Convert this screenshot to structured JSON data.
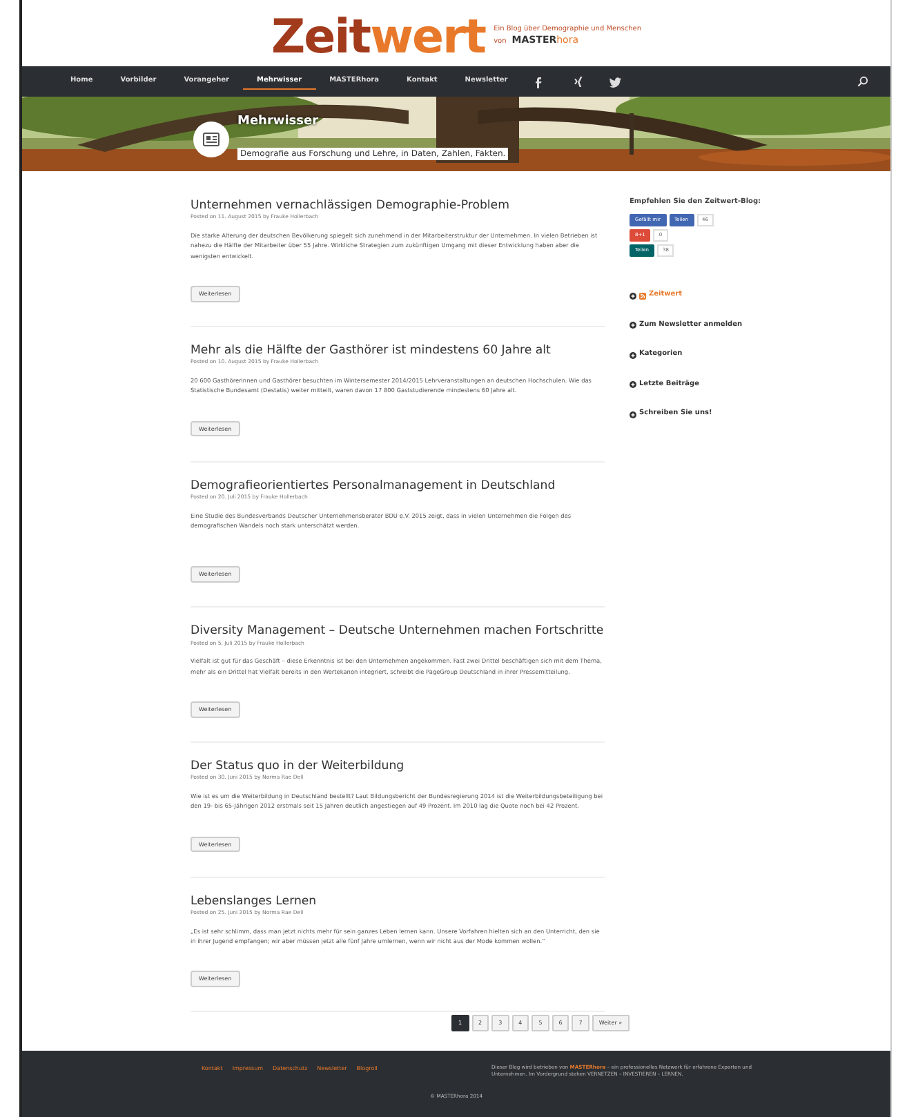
{
  "header": {
    "logo_part_1": "Zeit",
    "logo_part_2": "wert",
    "tagline": "Ein Blog über Demographie und Menschen",
    "tagline_by": "von",
    "brand_part_1": "MASTER",
    "brand_part_2": "hora"
  },
  "nav": {
    "items": [
      {
        "label": "Home",
        "selected": false
      },
      {
        "label": "Vorbilder",
        "selected": false
      },
      {
        "label": "Vorangeher",
        "selected": false
      },
      {
        "label": "Mehrwisser",
        "selected": true
      },
      {
        "label": "MASTERhora",
        "selected": false
      },
      {
        "label": "Kontakt",
        "selected": false
      },
      {
        "label": "Newsletter",
        "selected": false
      }
    ],
    "social": [
      {
        "kind": "facebook"
      },
      {
        "kind": "xing"
      },
      {
        "kind": "twitter"
      }
    ]
  },
  "hero": {
    "title": "Mehrwisser",
    "subtitle": "Demografie aus Forschung und Lehre, in Daten, Zahlen, Fakten."
  },
  "posts": [
    {
      "title": "Unternehmen vernachlässigen Demographie-Problem",
      "meta": "Posted on 11. August 2015 by Frauke Hollerbach",
      "excerpt": "Die starke Alterung der deutschen Bevölkerung spiegelt sich zunehmend in der Mitarbeiterstruktur der Unternehmen. In vielen Betrieben ist nahezu die Hälfte der Mitarbeiter über 55 Jahre. Wirkliche Strategien zum zukünftigen Umgang mit dieser Entwicklung haben aber die wenigsten entwickelt.",
      "button": "Weiterlesen"
    },
    {
      "title": "Mehr als die Hälfte der Gasthörer ist mindestens 60 Jahre alt",
      "meta": "Posted on 10. August 2015 by Frauke Hollerbach",
      "excerpt": "20 600 Gasthörerinnen und Gasthörer besuchten im Wintersemester 2014/2015 Lehrveranstaltungen an deutschen Hochschulen. Wie das Statistische Bundesamt (Destatis) weiter mitteilt, waren davon 17 800 Gaststudierende mindestens 60 Jahre alt.",
      "button": "Weiterlesen"
    },
    {
      "title": "Demografieorientiertes Personalmanagement in Deutschland",
      "meta": "Posted on 20. Juli 2015 by Frauke Hollerbach",
      "excerpt": "Eine Studie des Bundesverbands Deutscher Unternehmensberater BDU e.V. 2015 zeigt, dass in vielen Unternehmen die Folgen des demografischen Wandels noch stark unterschätzt werden.",
      "button": "Weiterlesen"
    },
    {
      "title": "Diversity Management – Deutsche Unternehmen machen Fortschritte",
      "meta": "Posted on 5. Juli 2015 by Frauke Hollerbach",
      "excerpt": "Vielfalt ist gut für das Geschäft – diese Erkenntnis ist bei den Unternehmen angekommen. Fast zwei Drittel beschäftigen sich mit dem Thema, mehr als ein Drittel hat Vielfalt bereits in den Wertekanon integriert, schreibt die PageGroup Deutschland in ihrer Pressemitteilung.",
      "button": "Weiterlesen"
    },
    {
      "title": "Der Status quo in der Weiterbildung",
      "meta": "Posted on 30. Juni 2015 by Norma Rae Dell",
      "excerpt": "Wie ist es um die Weiterbildung in Deutschland bestellt? Laut Bildungsbericht der Bundesregierung 2014 ist die Weiterbildungsbeteiligung bei den 19- bis 65-Jährigen 2012 erstmals seit 15 Jahren deutlich angestiegen auf 49 Prozent. Im 2010 lag die Quote noch bei 42 Prozent.",
      "button": "Weiterlesen"
    },
    {
      "title": "Lebenslanges Lernen",
      "meta": "Posted on 25. Juni 2015 by Norma Rae Dell",
      "excerpt": "„Es ist sehr schlimm, dass man jetzt nichts mehr für sein ganzes Leben lernen kann. Unsere Vorfahren hielten sich an den Unterricht, den sie in ihrer Jugend empfangen; wir aber müssen jetzt alle fünf Jahre umlernen, wenn wir nicht aus der Mode kommen wollen.“",
      "button": "Weiterlesen"
    }
  ],
  "sidebar": {
    "heading": "Empfehlen Sie den Zeitwert-Blog:",
    "share_rows": [
      {
        "kind": "facebook",
        "labels": [
          "Gefällt mir",
          "Teilen"
        ],
        "count": "46"
      },
      {
        "kind": "googleplus",
        "labels": [
          "8+1"
        ],
        "count": "0"
      },
      {
        "kind": "xing",
        "labels": [
          "Teilen"
        ],
        "count": "38"
      }
    ],
    "widgets": [
      {
        "label": "Zeitwert",
        "kind": "feed"
      },
      {
        "label": "Zum Newsletter anmelden",
        "kind": "plain"
      },
      {
        "label": "Kategorien",
        "kind": "plain"
      },
      {
        "label": "Letzte Beiträge",
        "kind": "plain"
      },
      {
        "label": "Schreiben Sie uns!",
        "kind": "plain"
      }
    ]
  },
  "pagination": [
    {
      "label": "1",
      "selected": true
    },
    {
      "label": "2",
      "selected": false
    },
    {
      "label": "3",
      "selected": false
    },
    {
      "label": "4",
      "selected": false
    },
    {
      "label": "5",
      "selected": false
    },
    {
      "label": "6",
      "selected": false
    },
    {
      "label": "7",
      "selected": false
    },
    {
      "label": "Weiter »",
      "selected": false
    }
  ],
  "footer": {
    "links": [
      "Kontakt",
      "Impressum",
      "Datenschutz",
      "Newsletter",
      "Blogroll"
    ],
    "about": "Dieser Blog wird betrieben von **MASTERhora** – ein professionelles Netzwerk für erfahrene Experten und Unternehmen. Im Vordergrund stehen VERNETZEN – INVESTIEREN – LERNEN.",
    "copyright": "© MASTERhora 2014"
  }
}
